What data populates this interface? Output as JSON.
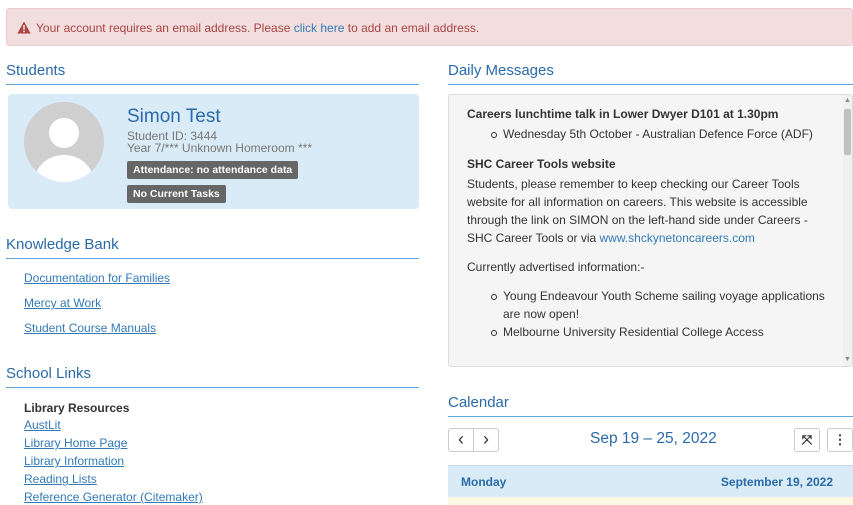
{
  "alert": {
    "text_before": "Your account requires an email address. Please ",
    "link_text": "click here",
    "text_after": " to add an email address."
  },
  "students": {
    "title": "Students",
    "student": {
      "name": "Simon Test",
      "id_line": "Student ID: 3444",
      "homeroom_line": "Year 7/*** Unknown Homeroom ***",
      "attendance_badge": "Attendance: no attendance data",
      "tasks_badge": "No Current Tasks"
    }
  },
  "knowledge_bank": {
    "title": "Knowledge Bank",
    "links": [
      "Documentation for Families",
      "Mercy at Work",
      "Student Course Manuals"
    ]
  },
  "school_links": {
    "title": "School Links",
    "heading": "Library Resources",
    "links": [
      "AustLit",
      "Library Home Page",
      "Library Information",
      "Reading Lists",
      "Reference Generator (Citemaker)"
    ]
  },
  "daily_messages": {
    "title": "Daily Messages",
    "msg1_title": "Careers lunchtime talk in Lower Dwyer D101 at 1.30pm",
    "msg1_item": "Wednesday 5th October - Australian Defence Force (ADF)",
    "msg2_title": "SHC Career Tools website",
    "msg2_body": "Students, please remember to keep checking our Career Tools website for all information on careers. This website is accessible through the link on SIMON on the left-hand side under Careers - SHC Career Tools or via ",
    "msg2_link": "www.shckynetoncareers.com",
    "msg3_intro": "Currently advertised information:-",
    "msg3_items": [
      "Young Endeavour Youth Scheme sailing voyage applications are now open!",
      "Melbourne University Residential College Access"
    ]
  },
  "calendar": {
    "title": "Calendar",
    "prev_label": "‹",
    "next_label": "›",
    "date_range": "Sep 19 – 25, 2022",
    "expand_label": "⤧",
    "more_label": "⋮",
    "day_name": "Monday",
    "day_date": "September 19, 2022"
  },
  "colors": {
    "accent": "#2a6aa8",
    "link": "#337ab7",
    "alert_bg": "#f2dede",
    "alert_text": "#a94442",
    "card_bg": "#d9ebf7"
  }
}
